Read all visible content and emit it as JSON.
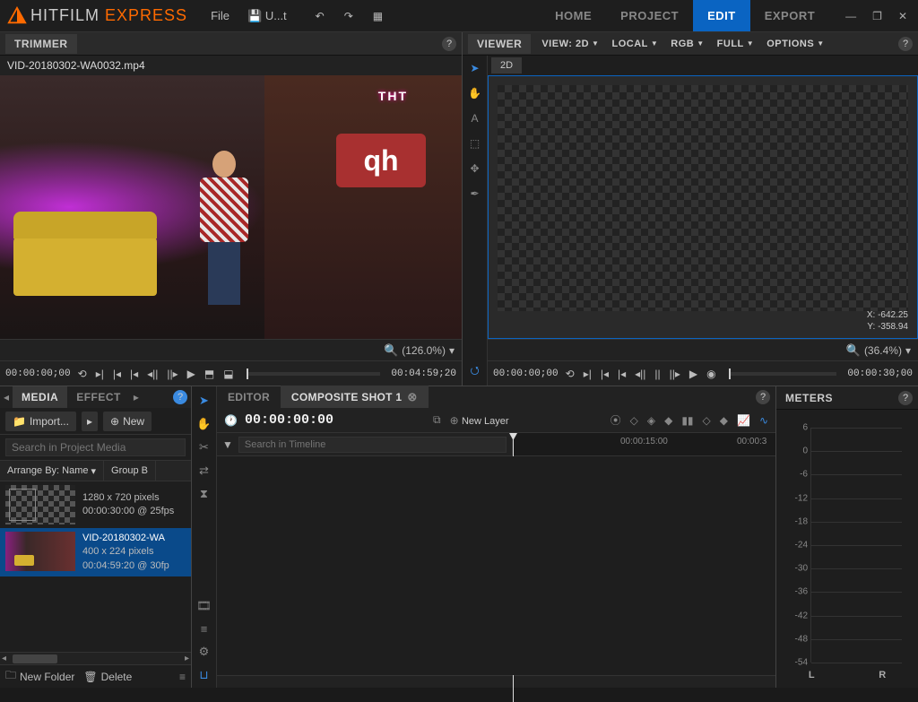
{
  "app": {
    "brand1": "HITFILM",
    "brand2": "EXPRESS"
  },
  "menu": {
    "file": "File",
    "save": "U...t"
  },
  "nav": {
    "home": "HOME",
    "project": "PROJECT",
    "edit": "EDIT",
    "export": "EXPORT"
  },
  "trimmer": {
    "title": "TRIMMER",
    "clip": "VID-20180302-WA0032.mp4",
    "zoom": "(126.0%)",
    "tc_in": "00:00:00;00",
    "tc_out": "00:04:59;20",
    "scene_logo": "ТНТ",
    "scene_sign": "qh"
  },
  "viewer": {
    "title": "VIEWER",
    "view": "VIEW: 2D",
    "local": "LOCAL",
    "rgb": "RGB",
    "full": "FULL",
    "options": "OPTIONS",
    "tab": "2D",
    "coord_x": "X:   -642.25",
    "coord_y": "Y:   -358.94",
    "zoom": "(36.4%)",
    "tc_in": "00:00:00;00",
    "tc_out": "00:00:30;00"
  },
  "media": {
    "tab_media": "MEDIA",
    "tab_effects": "EFFECT",
    "import": "Import...",
    "new": "New",
    "search_ph": "Search in Project Media",
    "arrange": "Arrange By: Name",
    "group": "Group B",
    "items": [
      {
        "name": "",
        "dim": "1280 x 720 pixels",
        "dur": "00:00:30:00 @ 25fps"
      },
      {
        "name": "VID-20180302-WA",
        "dim": "400 x 224 pixels",
        "dur": "00:04:59:20 @ 30fp"
      }
    ],
    "newfolder": "New Folder",
    "delete": "Delete"
  },
  "editor": {
    "tab_editor": "EDITOR",
    "tab_comp": "COMPOSITE SHOT 1",
    "tc": "00:00:00:00",
    "newlayer": "New Layer",
    "search_ph": "Search in Timeline",
    "ruler": [
      "00:00:15:00",
      "00:00:3"
    ]
  },
  "meters": {
    "title": "METERS",
    "scale": [
      "6",
      "0",
      "-6",
      "-12",
      "-18",
      "-24",
      "-30",
      "-36",
      "-42",
      "-48",
      "-54"
    ],
    "L": "L",
    "R": "R"
  }
}
